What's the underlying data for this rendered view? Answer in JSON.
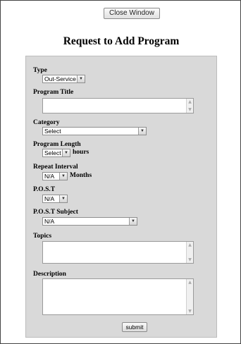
{
  "window": {
    "close_label": "Close Window"
  },
  "page": {
    "title": "Request to Add Program"
  },
  "form": {
    "type": {
      "label": "Type",
      "value": "Out-Service"
    },
    "program_title": {
      "label": "Program Title",
      "value": ""
    },
    "category": {
      "label": "Category",
      "value": "Select"
    },
    "program_length": {
      "label": "Program Length",
      "value": "Select",
      "unit": "hours"
    },
    "repeat_interval": {
      "label": "Repeat Interval",
      "value": "N/A",
      "unit": "Months"
    },
    "post": {
      "label": "P.O.S.T",
      "value": "N/A"
    },
    "post_subject": {
      "label": "P.O.S.T Subject",
      "value": "N/A"
    },
    "topics": {
      "label": "Topics",
      "value": ""
    },
    "description": {
      "label": "Description",
      "value": ""
    },
    "submit_label": "submit"
  },
  "icons": {
    "dropdown": "chevron-down-icon",
    "scroll_up": "scroll-up-icon",
    "scroll_down": "scroll-down-icon"
  }
}
